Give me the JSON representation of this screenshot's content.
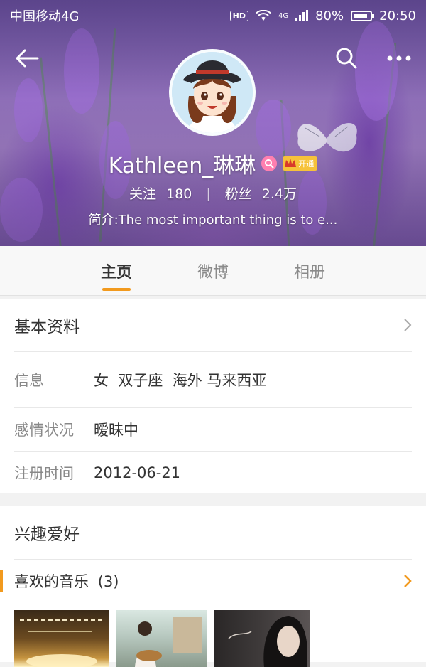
{
  "status_bar": {
    "carrier": "中国移动4G",
    "hd": "HD",
    "network": "4G",
    "battery": "80%",
    "time": "20:50"
  },
  "header": {
    "back_icon": "back-arrow-icon",
    "search_icon": "search-icon",
    "more_icon": "more-dots-icon"
  },
  "profile": {
    "username": "Kathleen_琳琳",
    "vip_label": "开通",
    "following_label": "关注",
    "following_count": "180",
    "followers_label": "粉丝",
    "followers_count": "2.4万",
    "bio": "简介:The most important thing is to e..."
  },
  "tabs": [
    {
      "label": "主页",
      "active": true
    },
    {
      "label": "微博",
      "active": false
    },
    {
      "label": "相册",
      "active": false
    }
  ],
  "basic_info": {
    "title": "基本资料",
    "rows": [
      {
        "label": "信息",
        "value": "女  双子座  海外 马来西亚"
      },
      {
        "label": "感情状况",
        "value": "暧昧中"
      },
      {
        "label": "注册时间",
        "value": "2012-06-21"
      }
    ]
  },
  "interests": {
    "title": "兴趣爱好",
    "music_label": "喜欢的音乐",
    "music_count": "(3)"
  },
  "colors": {
    "accent": "#f29a1e",
    "vip_gold": "#f6c23a"
  }
}
